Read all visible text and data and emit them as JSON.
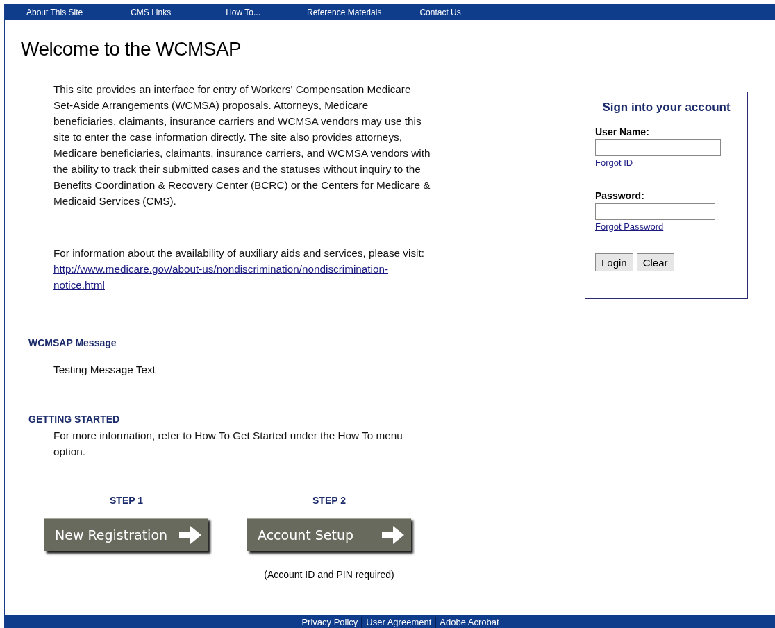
{
  "nav": {
    "items": [
      {
        "label": "About This Site"
      },
      {
        "label": "CMS Links"
      },
      {
        "label": "How To..."
      },
      {
        "label": "Reference Materials"
      },
      {
        "label": "Contact Us"
      }
    ]
  },
  "title": "Welcome to the WCMSAP",
  "intro": "This site provides an interface for entry of Workers' Compensation Medicare Set-Aside Arrangements (WCMSA) proposals. Attorneys, Medicare beneficiaries, claimants, insurance carriers and WCMSA vendors may use this site to enter the case information directly. The site also provides attorneys, Medicare beneficiaries, claimants, insurance carriers, and WCMSA vendors with the ability to track their submitted cases and the statuses without inquiry to the Benefits Coordination & Recovery Center (BCRC) or the Centers for Medicare & Medicaid Services (CMS).",
  "aids": {
    "text": "For information about the availability of auxiliary aids and services, please visit:",
    "link": "http://www.medicare.gov/about-us/nondiscrimination/nondiscrimination-notice.html"
  },
  "message": {
    "heading": "WCMSAP Message",
    "text": "Testing Message Text"
  },
  "getting_started": {
    "heading": "GETTING STARTED",
    "text": "For more information, refer to How To Get Started under the How To menu option."
  },
  "steps": [
    {
      "label": "STEP 1",
      "button": "New Registration"
    },
    {
      "label": "STEP 2",
      "button": "Account Setup",
      "note": "(Account ID and PIN required)"
    }
  ],
  "login": {
    "title": "Sign into your account",
    "user_label": "User Name:",
    "forgot_id": "Forgot ID",
    "password_label": "Password:",
    "forgot_password": "Forgot Password",
    "buttons": [
      "Login",
      "Clear"
    ]
  },
  "footer": {
    "links": [
      "Privacy Policy",
      "User Agreement",
      "Adobe Acrobat"
    ]
  }
}
